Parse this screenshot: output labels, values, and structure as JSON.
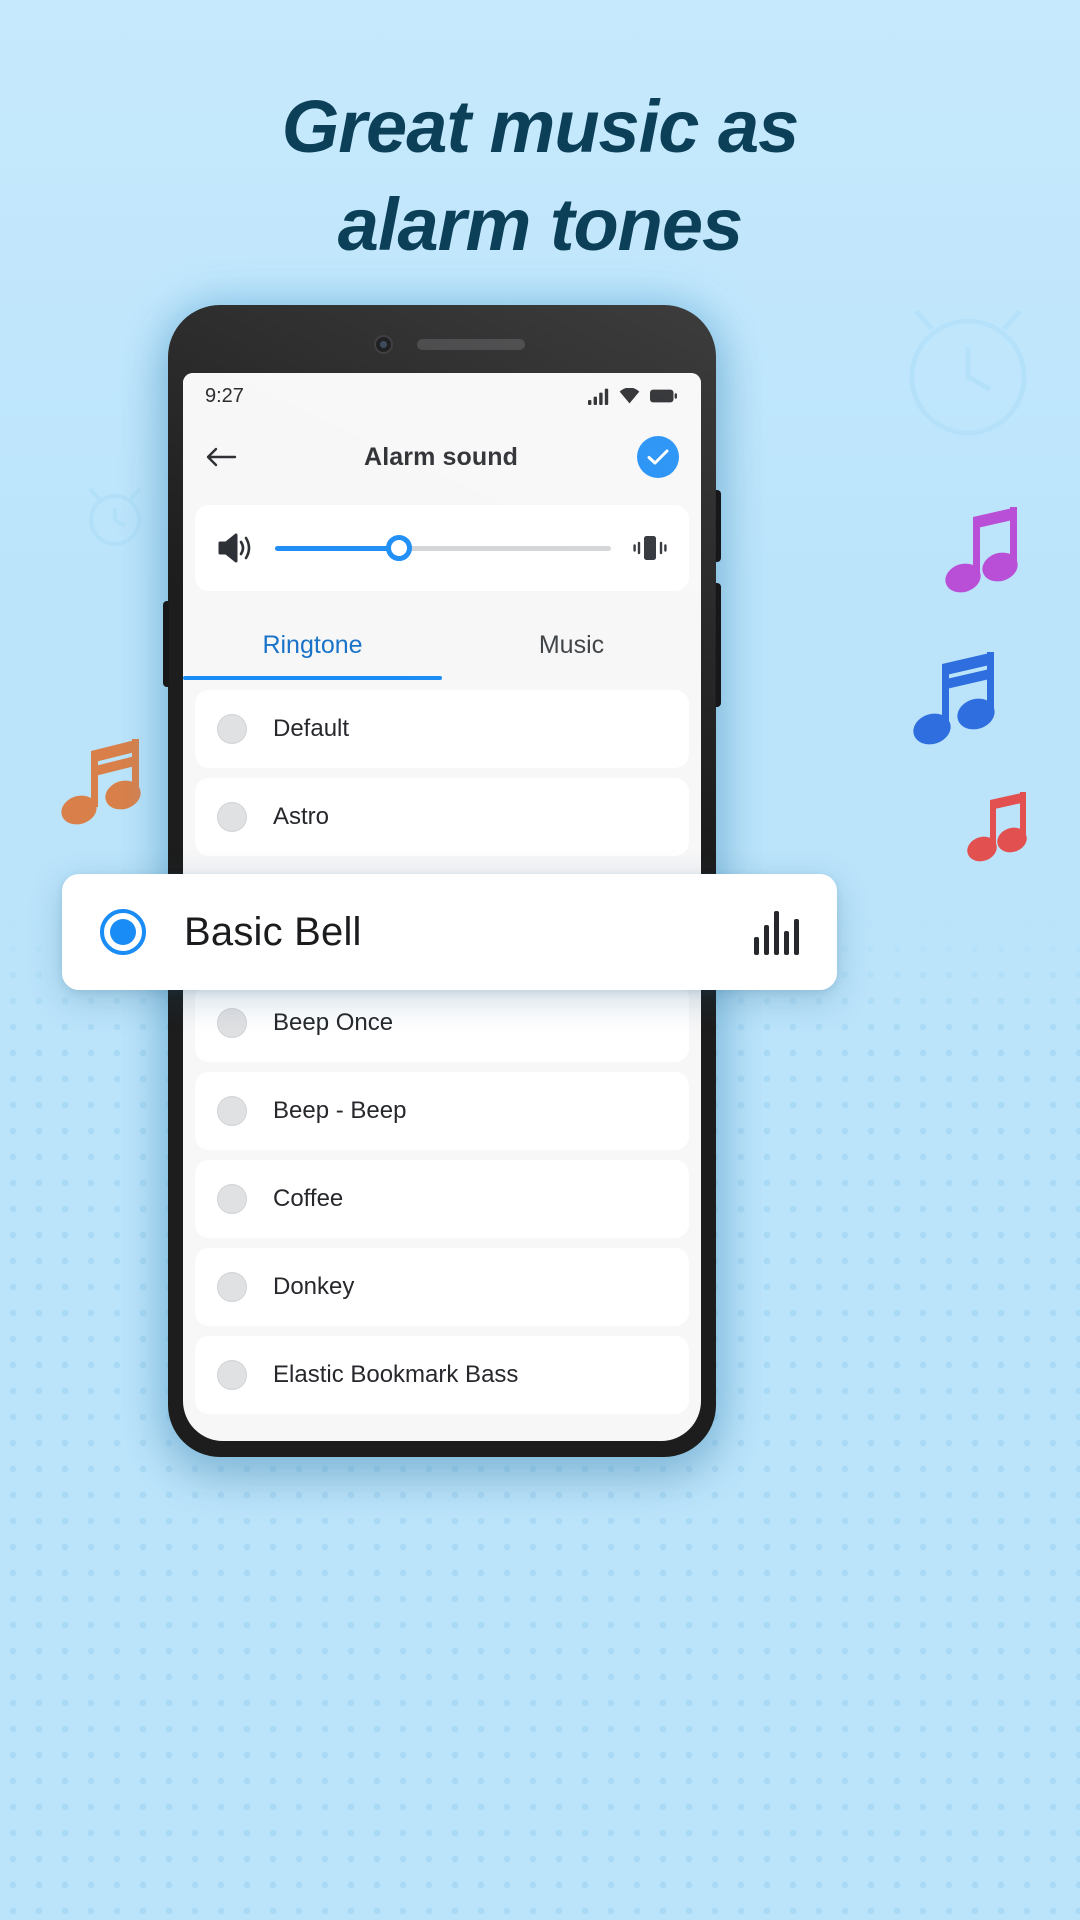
{
  "headline": {
    "line1": "Great music as",
    "line2": "alarm tones",
    "color": "#0c4058"
  },
  "theme": {
    "background": "#bbe4fb",
    "accent": "#1a8cf5",
    "card": "#ffffff",
    "screen_bg": "#f7f7f8",
    "text": "#26282c"
  },
  "phone": {
    "statusbar": {
      "time": "9:27",
      "icons": [
        "signal-icon",
        "wifi-icon",
        "battery-icon"
      ]
    },
    "appbar": {
      "back_icon": "back-arrow-icon",
      "title": "Alarm sound",
      "confirm_icon": "check-icon"
    },
    "volume": {
      "speaker_icon": "speaker-icon",
      "vibrate_icon": "vibrate-icon",
      "value_percent": 37
    },
    "tabs": [
      {
        "label": "Ringtone",
        "active": true
      },
      {
        "label": "Music",
        "active": false
      }
    ],
    "sounds_above": [
      {
        "label": "Default",
        "selected": false
      },
      {
        "label": "Astro",
        "selected": false
      }
    ],
    "sounds_below": [
      {
        "label": "Beep Once",
        "selected": false
      },
      {
        "label": "Beep - Beep",
        "selected": false
      },
      {
        "label": "Coffee",
        "selected": false
      },
      {
        "label": "Donkey",
        "selected": false
      },
      {
        "label": "Elastic Bookmark Bass",
        "selected": false
      }
    ]
  },
  "highlight_card": {
    "label": "Basic Bell",
    "selected": true,
    "waveform_icon": "waveform-icon"
  },
  "decorations": {
    "notes": [
      "music-note-purple",
      "music-note-blue",
      "music-note-red",
      "music-note-orange"
    ],
    "clocks": [
      "alarm-clock-outline-large",
      "alarm-clock-outline-small"
    ]
  }
}
